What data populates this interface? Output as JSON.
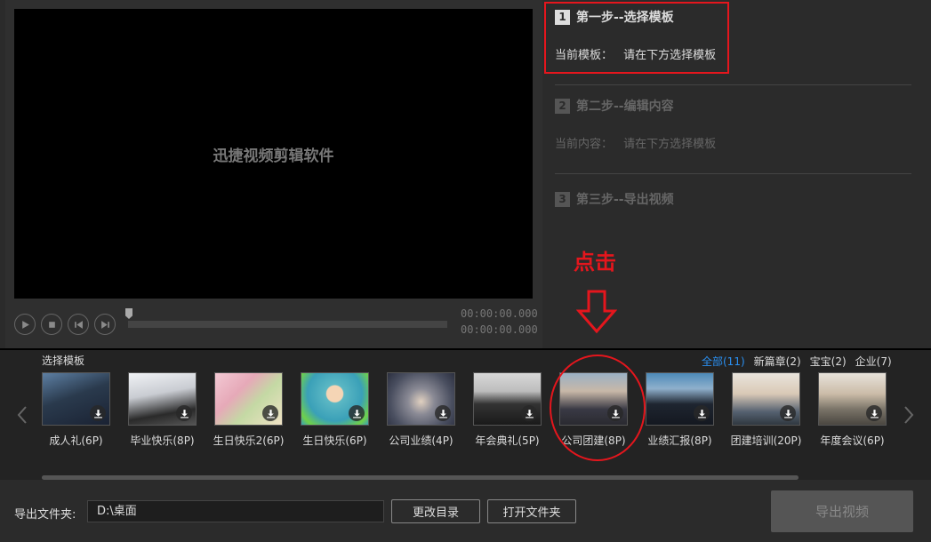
{
  "preview": {
    "video_text": "迅捷视频剪辑软件",
    "time_current": "00:00:00.000",
    "time_total": "00:00:00.000",
    "controls": [
      "play-icon",
      "stop-icon",
      "prev-frame-icon",
      "next-frame-icon"
    ]
  },
  "steps": {
    "step1": {
      "num": "1",
      "title": "第一步--选择模板",
      "sub_label": "当前模板：",
      "sub_value": "请在下方选择模板"
    },
    "step2": {
      "num": "2",
      "title": "第二步--编辑内容",
      "sub_label": "当前内容：",
      "sub_value": "请在下方选择模板"
    },
    "step3": {
      "num": "3",
      "title": "第三步--导出视频"
    }
  },
  "annotation": {
    "click_text": "点击"
  },
  "templates": {
    "label": "选择模板",
    "filters": [
      {
        "label": "全部(11)",
        "active": true
      },
      {
        "label": "新篇章(2)",
        "active": false
      },
      {
        "label": "宝宝(2)",
        "active": false
      },
      {
        "label": "企业(7)",
        "active": false
      }
    ],
    "items": [
      {
        "label": "成人礼(6P)"
      },
      {
        "label": "毕业快乐(8P)"
      },
      {
        "label": "生日快乐2(6P)"
      },
      {
        "label": "生日快乐(6P)"
      },
      {
        "label": "公司业绩(4P)"
      },
      {
        "label": "年会典礼(5P)"
      },
      {
        "label": "公司团建(8P)"
      },
      {
        "label": "业绩汇报(8P)"
      },
      {
        "label": "团建培训(20P)"
      },
      {
        "label": "年度会议(6P)"
      }
    ]
  },
  "output": {
    "folder_label": "导出文件夹:",
    "folder_value": "D:\\桌面",
    "change_dir": "更改目录",
    "open_folder": "打开文件夹",
    "export": "导出视频"
  },
  "colors": {
    "accent_red": "#e5161d",
    "accent_blue": "#2a8ff0"
  }
}
